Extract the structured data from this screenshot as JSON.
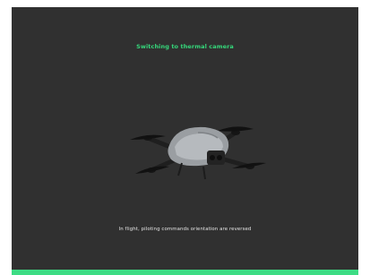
{
  "screen": {
    "status_title": "Switching to thermal camera",
    "notice_text": "In flight, piloting commands orientation are reversed"
  },
  "progress": {
    "fraction": 1.0
  },
  "icons": {
    "drone": "drone-illustration"
  },
  "colors": {
    "background": "#303030",
    "accent": "#3ddc84",
    "title": "#35d67a",
    "text": "#e6e6e6"
  }
}
